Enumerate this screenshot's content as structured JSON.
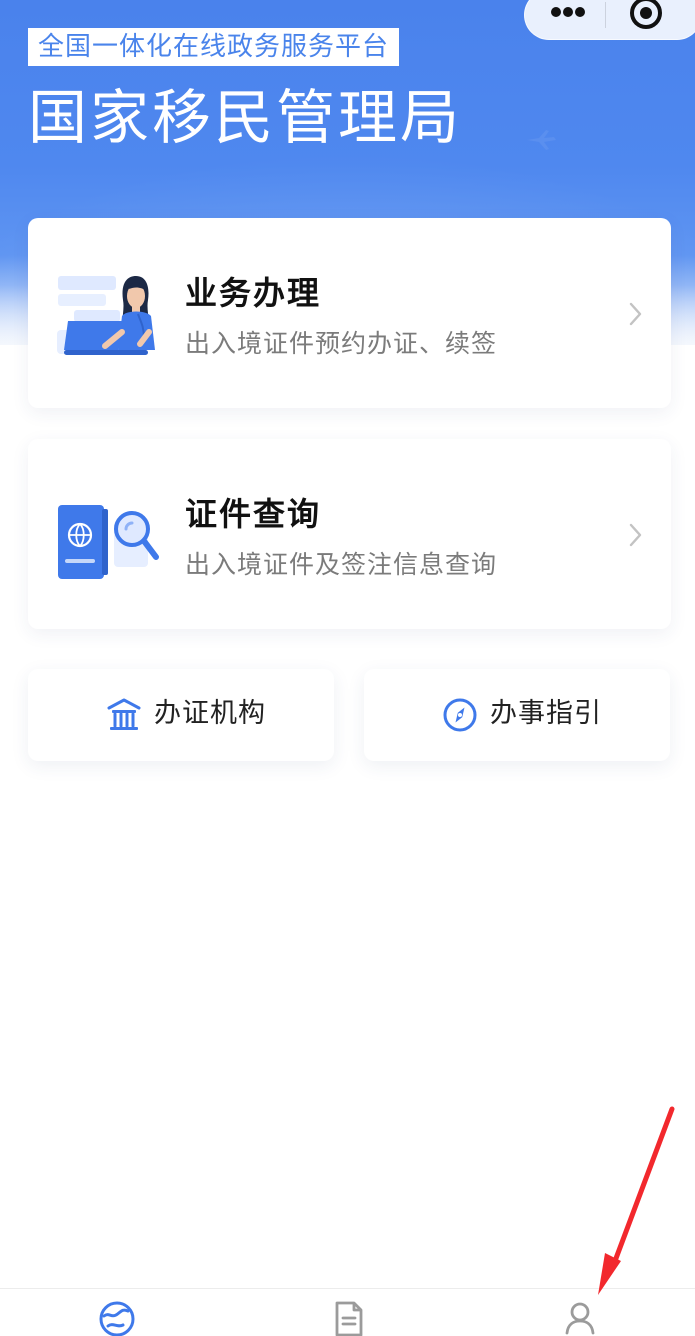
{
  "header": {
    "platform_badge": "全国一体化在线政务服务平台",
    "title": "国家移民管理局"
  },
  "top_controls": {
    "more_icon": "more-icon",
    "target_icon": "target-icon"
  },
  "cards": [
    {
      "title": "业务办理",
      "subtitle": "出入境证件预约办证、续签",
      "icon": "office-worker-illustration-icon"
    },
    {
      "title": "证件查询",
      "subtitle": "出入境证件及签注信息查询",
      "icon": "passport-search-icon"
    }
  ],
  "quick_links": [
    {
      "label": "办证机构",
      "icon": "bank-icon"
    },
    {
      "label": "办事指引",
      "icon": "compass-icon"
    }
  ],
  "tabbar": {
    "items": [
      {
        "icon": "globe-icon"
      },
      {
        "icon": "document-icon"
      },
      {
        "icon": "user-icon"
      }
    ]
  },
  "colors": {
    "brand_blue": "#4a84eb",
    "card_text": "#111111",
    "subtitle_text": "#7b7b7b",
    "annotation_red": "#f2282d"
  }
}
